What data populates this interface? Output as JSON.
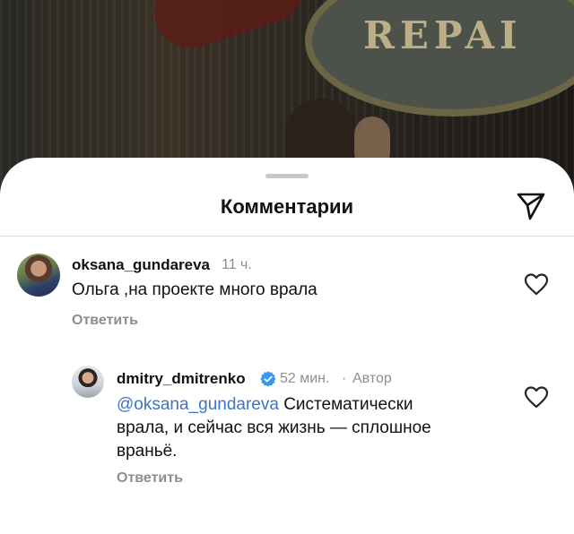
{
  "background": {
    "sign_text": "REPAI"
  },
  "sheet": {
    "title": "Комментарии"
  },
  "comments": [
    {
      "username": "oksana_gundareva",
      "time": "11 ч.",
      "text": "Ольга ,на проекте  много  врала",
      "reply_label": "Ответить"
    },
    {
      "username": "dmitry_dmitrenko",
      "time": "52 мин.",
      "separator": "·",
      "author_label": "Автор",
      "mention": "@oksana_gundareva",
      "text_line1": " Систематически",
      "text_line2": "врала, и сейчас вся жизнь — сплошное",
      "text_line3": "враньё.",
      "reply_label": "Ответить"
    }
  ],
  "colors": {
    "mention": "#3f74c4",
    "verified": "#3897f0",
    "meta": "#8e8e8e"
  }
}
